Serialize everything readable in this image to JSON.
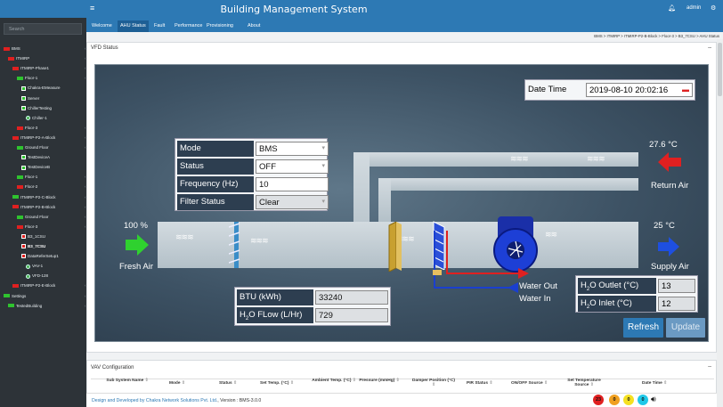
{
  "topbar": {
    "title": "Building Management System",
    "user": "admin"
  },
  "sidebar": {
    "search_placeholder": "Search",
    "nodes": [
      {
        "label": "BMS",
        "lvl": 0,
        "type": "red"
      },
      {
        "label": "ITMIRP",
        "lvl": 1,
        "type": "red"
      },
      {
        "label": "ITMIRP-Phase1",
        "lvl": 2,
        "type": "red"
      },
      {
        "label": "Floor-1",
        "lvl": 3,
        "type": "green"
      },
      {
        "label": "Chakra-EMeasure",
        "lvl": 4,
        "type": "sq"
      },
      {
        "label": "Server",
        "lvl": 4,
        "type": "sq"
      },
      {
        "label": "ChillerTesting",
        "lvl": 4,
        "type": "sq"
      },
      {
        "label": "Chiller-1",
        "lvl": 5,
        "type": "cir"
      },
      {
        "label": "Floor-3",
        "lvl": 3,
        "type": "red"
      },
      {
        "label": "ITMIRP-P2-A-Block",
        "lvl": 2,
        "type": "red"
      },
      {
        "label": "Ground Floor",
        "lvl": 3,
        "type": "green"
      },
      {
        "label": "TestDeviceA",
        "lvl": 4,
        "type": "sq"
      },
      {
        "label": "TestDeviceB",
        "lvl": 4,
        "type": "sq"
      },
      {
        "label": "Floor-1",
        "lvl": 3,
        "type": "green"
      },
      {
        "label": "Floor-2",
        "lvl": 3,
        "type": "red"
      },
      {
        "label": "ITMIRP-P2-C-Block",
        "lvl": 2,
        "type": "green"
      },
      {
        "label": "ITMIRP-P2-B-Block",
        "lvl": 2,
        "type": "red"
      },
      {
        "label": "Ground Floor",
        "lvl": 3,
        "type": "green"
      },
      {
        "label": "Floor-3",
        "lvl": 3,
        "type": "red"
      },
      {
        "label": "B3_1CSU",
        "lvl": 4,
        "type": "sqr"
      },
      {
        "label": "B3_7CSU",
        "lvl": 4,
        "type": "sqr",
        "selected": true
      },
      {
        "label": "DataReferSetup1",
        "lvl": 4,
        "type": "sqr"
      },
      {
        "label": "VAV-1",
        "lvl": 5,
        "type": "cir"
      },
      {
        "label": "VFD-128",
        "lvl": 5,
        "type": "cir"
      },
      {
        "label": "ITMIRP-P2-E-Block",
        "lvl": 2,
        "type": "red"
      },
      {
        "label": "Settings",
        "lvl": 0,
        "type": "green"
      },
      {
        "label": "TestedBuilding",
        "lvl": 1,
        "type": "green"
      }
    ]
  },
  "tabs": [
    {
      "label": "Welcome",
      "active": false
    },
    {
      "label": "AHU Status",
      "active": true
    },
    {
      "label": "Fault",
      "active": false
    },
    {
      "label": "Performance",
      "active": false
    },
    {
      "label": "Provisioning",
      "active": false
    },
    {
      "label": "About",
      "active": false
    }
  ],
  "breadcrumb": "BMS > ITMIRP > ITMIRP-P2-B-Block > Floor-3 > B3_7CSU > AHU Status",
  "vfd": {
    "panel_title": "VFD Status",
    "datetime": {
      "label": "Date Time",
      "value": "2019-08-10 20:02:16"
    },
    "form": [
      {
        "label": "Mode",
        "value": "BMS",
        "select": true
      },
      {
        "label": "Status",
        "value": "OFF",
        "select": true
      },
      {
        "label": "Frequency (Hz)",
        "value": "10",
        "select": false
      },
      {
        "label": "Filter Status",
        "value": "Clear",
        "select": true
      }
    ],
    "fresh_air": {
      "label": "Fresh Air",
      "value": "100 %"
    },
    "return_air": {
      "label": "Return Air",
      "value": "27.6 °C"
    },
    "supply_air": {
      "label": "Supply Air",
      "value": "25 °C"
    },
    "water_out": "Water Out",
    "water_in": "Water In",
    "btu": {
      "label": "BTU (kWh)",
      "value": "33240"
    },
    "h2o_flow": {
      "label_pre": "H",
      "label_sub": "2",
      "label_post": "O FLow (L/Hr)",
      "value": "729"
    },
    "h2o_outlet": {
      "label_pre": "H",
      "label_sub": "2",
      "label_post": "O Outlet (°C)",
      "value": "13"
    },
    "h2o_inlet": {
      "label_pre": "H",
      "label_sub": "2",
      "label_post": "O Inlet (°C)",
      "value": "12"
    },
    "refresh_label": "Refresh",
    "update_label": "Update",
    "colors": {
      "duct": "#c6d1d8",
      "water_out": "#e02020",
      "water_in": "#1a3fcf",
      "fresh": "#2fd12f",
      "supply": "#1e4fe0",
      "return": "#e02020"
    }
  },
  "vav": {
    "panel_title": "VAV Configuration",
    "columns": [
      "Sub System Name",
      "Mode",
      "Status",
      "Set Temp. (°C)",
      "Ambient Temp. (°C)",
      "Pressure (mmHg)",
      "Damper Position (°C)",
      "PIR Status",
      "ON/OFF Source",
      "Set Temperature Source",
      "Date Time"
    ]
  },
  "footer": {
    "credit": "Design and Developed by Chakra Network Solutions Pvt. Ltd.",
    "version": ", Version : BMS-3.0.0"
  },
  "alarms": [
    {
      "value": "23",
      "color": "#e02020"
    },
    {
      "value": "0",
      "color": "#f0a020"
    },
    {
      "value": "0",
      "color": "#f5e020"
    },
    {
      "value": "0",
      "color": "#20c8e8"
    }
  ]
}
